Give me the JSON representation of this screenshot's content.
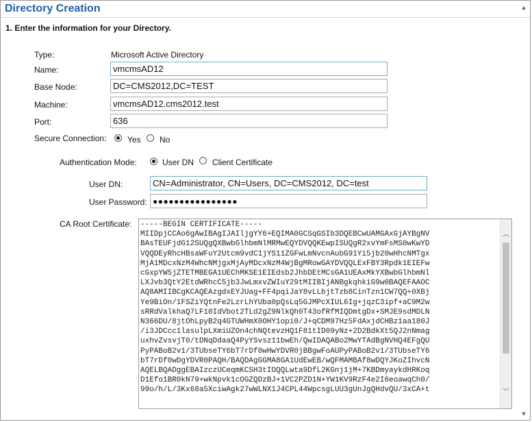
{
  "header": {
    "title": "Directory Creation"
  },
  "step": {
    "title": "1. Enter the information for your Directory."
  },
  "form": {
    "type_label": "Type:",
    "type_value": "Microsoft Active Directory",
    "name_label": "Name:",
    "name_value": "vmcmsAD12",
    "base_node_label": "Base Node:",
    "base_node_value": "DC=CMS2012,DC=TEST",
    "machine_label": "Machine:",
    "machine_value": "vmcmsAD12.cms2012.test",
    "port_label": "Port:",
    "port_value": "636",
    "secure_label": "Secure Connection:",
    "secure_yes": "Yes",
    "secure_no": "No",
    "secure_selected": "Yes",
    "auth_label": "Authentication Mode:",
    "auth_userdn": "User DN",
    "auth_clientcert": "Client Certificate",
    "auth_selected": "User DN",
    "user_dn_label": "User DN:",
    "user_dn_value": "CN=Administrator, CN=Users, DC=CMS2012, DC=test",
    "password_label": "User Password:",
    "password_value": "●●●●●●●●●●●●●●●●",
    "ca_label": "CA Root Certificate:",
    "ca_value": "-----BEGIN CERTIFICATE-----\nMIIDpjCCAo6gAwIBAgIJAIljgYY6+EQIMA0GCSqGSIb3DQEBCwUAMGAxGjAYBgNV\nBAsTEUFjdG12SUQgQXBwbGlhbmNlMRMwEQYDVQQKEwpISUQgR2xvYmFsMS0wKwYD\nVQQDEyRhcHBsaWFuY2Utcm9vdC1jYS11ZGFwLmNvcnAubG91Yi5jb20wHhcNMTgx\nMjA1MDcxNzM4WhcNMjgxMjAyMDcxNzM4WjBgMRowGAYDVQQLExFBY3Rpdk1EIEFw\ncGxpYW5jZTETMBEGA1UEChMKSE1EIEdsb2JhbDEtMCsGA1UEAxMkYXBwbGlhbmNl\nLXJvb3QtY2EtdWRhcC5jb3JwLmxvZWIuY29tMIIBIjANBgkqhkiG9w0BAQEFAAOC\nAQ8AMIIBCgKCAQEAzgdxEYJUag+FF4pqiJaY8vLLbjtTzb8CinTzn1CW7QQ+0XBj\nYe9BiOn/1FSZiYQtnFe2LzrLhYUba0pQsLq5GJMPcXIUL6Ig+jqzC3ipf+aC9M2w\nsRRdValkhaQ7LF10IdVbot2TLd2gZ9NlkQh0T43ofRfMIQDmtgDx+SMJE9sdMDLN\nN366DU/8jtOhLpyB2q4GTUWHmX0OHY1opi0/J+qCDM97Hz5FdAxjdCHBz1aa180J\n/i3JDCcc1lasulpLXmiUZOn4chNQtevzHQ1F81tID09yNz+2D2BdkXt5QJ2nNmag\nuxhvZvsvjT0/tDNqDdaaQ4PyYSvsz11bwEh/QwIDAQABo2MwYTAdBgNVHQ4EFgQU\nPyPABoB2v1/3TUbseTY6bT7rDf0wHwYDVR0jBBgwFoAUPyPABoB2v1/3TUbseTY6\nbT7rDf0wDgYDVR0PAQH/BAQDAgGGMA8GA1UdEwEB/wQFMAMBAf8wDQYJKoZIhvcN\nAQELBQADggEBAIzczUCeqmKCSH3tIOQQLwta9DfL2KGnj1jM+7KBDmyaykdHRKoq\nD1Efo1BR0kN79+wkNpvk1cOGZQDzBJ+1VC2PZD1N+YW1KV9RzF4e2I6eoawqCh0/\n99o/h/L/3Kx68a5XciwAgk27wWLNX1J4CPL44WpcsgLUU3gUnJgQHdvQU/3xCA+t"
  },
  "colors": {
    "header_title": "#1f5fa6",
    "focus_border": "#6fb0c4"
  }
}
